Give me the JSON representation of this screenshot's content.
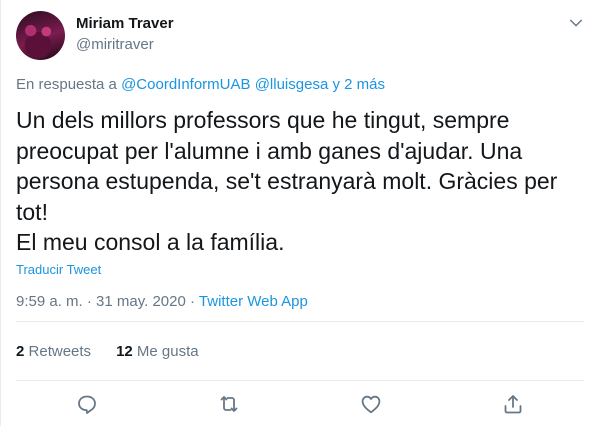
{
  "user": {
    "name": "Miriam Traver",
    "handle": "@miritraver"
  },
  "reply": {
    "prefix": "En respuesta a",
    "mention1": "@CoordInformUAB",
    "mention2": "@lluisgesa",
    "more": "y 2 más"
  },
  "tweet": {
    "line1": "Un dels millors professors que he tingut, sempre preocupat per l'alumne i amb ganes d'ajudar. Una persona estupenda, se't estranyarà molt. Gràcies per tot!",
    "line2": "El meu consol a la família."
  },
  "translate_label": "Traducir Tweet",
  "meta": {
    "time": "9:59 a. m.",
    "separator": "·",
    "date": "31 may. 2020",
    "source": "Twitter Web App"
  },
  "stats": {
    "retweets_count": "2",
    "retweets_label": "Retweets",
    "likes_count": "12",
    "likes_label": "Me gusta"
  },
  "icons": {
    "reply": "reply-icon",
    "retweet": "retweet-icon",
    "like": "heart-icon",
    "share": "share-icon",
    "menu": "chevron-down-icon"
  },
  "colors": {
    "link": "#1b95e0",
    "secondary": "#657786",
    "text": "#14171a",
    "divider": "#e6ecf0"
  }
}
